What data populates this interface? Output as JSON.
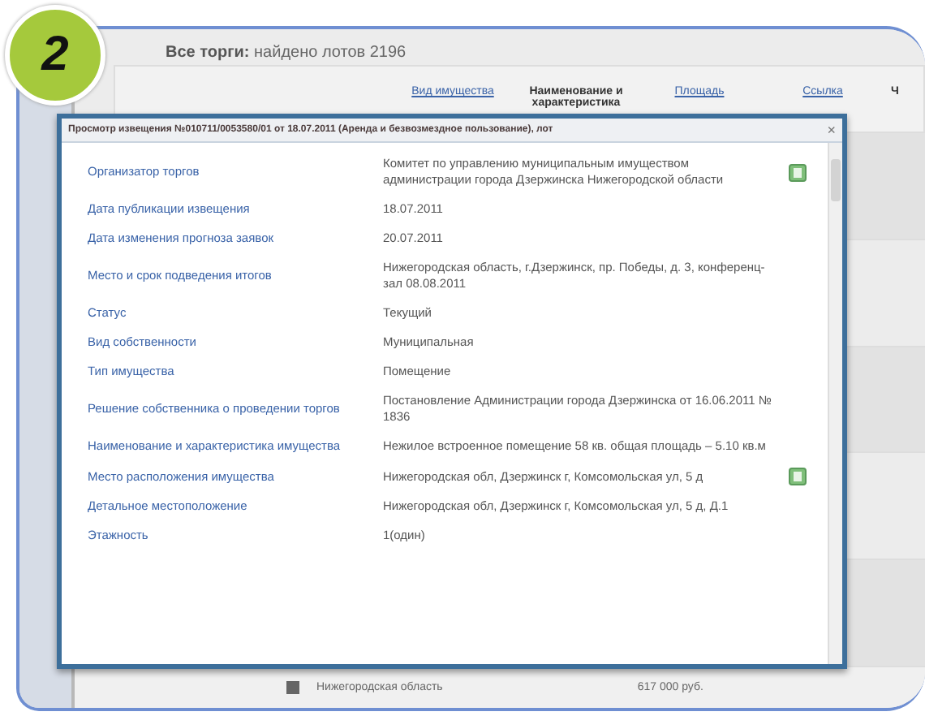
{
  "badge": "2",
  "page": {
    "title": "Все торги:",
    "count": "найдено лотов 2196"
  },
  "table": {
    "columns": [
      {
        "label": "Вид имущества",
        "link": true
      },
      {
        "label": "Наименование и характеристика",
        "link": false
      },
      {
        "label": "Площадь",
        "link": true
      },
      {
        "label": "Ссылка",
        "link": true
      },
      {
        "label": "Ч",
        "link": false
      }
    ],
    "bottom_row": {
      "address": "Нижегородская область",
      "price": "617 000 руб."
    }
  },
  "dialog": {
    "close": "×",
    "title": "Просмотр извещения №010711/0053580/01 от 18.07.2011 (Аренда и безвозмездное пользование), лот",
    "rows": [
      {
        "label": "Организатор торгов",
        "value": "Комитет по управлению муниципальным имуществом администрации города Дзержинска Нижегородской области",
        "icon": true
      },
      {
        "label": "Дата публикации извещения",
        "value": "18.07.2011",
        "icon": false
      },
      {
        "label": "Дата изменения прогноза заявок",
        "value": "20.07.2011",
        "icon": false
      },
      {
        "label": "Место и срок подведения итогов",
        "value": "Нижегородская область, г.Дзержинск, пр. Победы, д. 3, конференц-зал 08.08.2011",
        "icon": false
      },
      {
        "label": "Статус",
        "value": "Текущий",
        "icon": false
      },
      {
        "label": "Вид собственности",
        "value": "Муниципальная",
        "icon": false
      },
      {
        "label": "Тип имущества",
        "value": "Помещение",
        "icon": false
      },
      {
        "label": "Решение собственника о проведении торгов",
        "value": "Постановление Администрации города Дзержинска от 16.06.2011 № 1836",
        "icon": false
      },
      {
        "label": "Наименование и характеристика имущества",
        "value": "Нежилое встроенное помещение 58 кв. общая площадь – 5.10 кв.м",
        "icon": false
      },
      {
        "label": "Место расположения имущества",
        "value": "Нижегородская обл, Дзержинск г, Комсомольская ул, 5 д",
        "icon": true
      },
      {
        "label": "Детальное местоположение",
        "value": "Нижегородская обл, Дзержинск г, Комсомольская ул, 5 д, Д.1",
        "icon": false
      },
      {
        "label": "Этажность",
        "value": "1(один)",
        "icon": false
      }
    ]
  }
}
